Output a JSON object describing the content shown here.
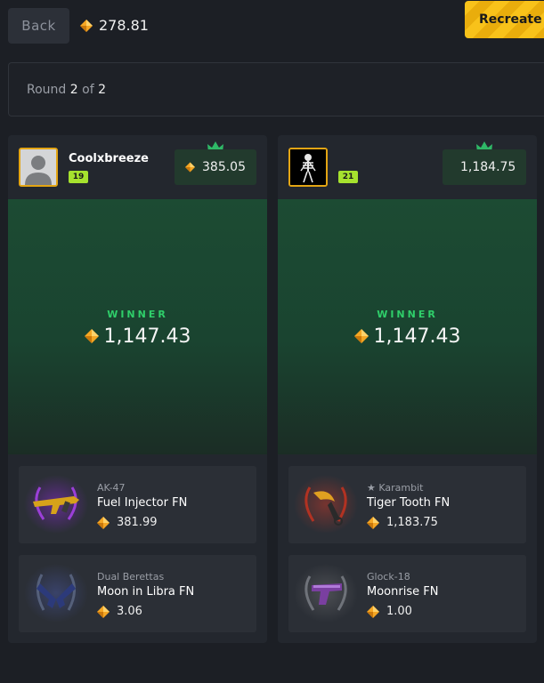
{
  "header": {
    "back_label": "Back",
    "balance": "278.81",
    "recreate_label": "Recreate"
  },
  "round": {
    "prefix": "Round",
    "current": "2",
    "of_label": "of",
    "total": "2"
  },
  "players": [
    {
      "name": "Coolxbreeze",
      "level": "19",
      "total": "385.05",
      "winner_label": "WINNER",
      "winner_amount": "1,147.43",
      "items": [
        {
          "weapon": "AK-47",
          "skin": "Fuel Injector FN",
          "price": "381.99",
          "icon": "ak47-icon",
          "glow": "#8b2bd1"
        },
        {
          "weapon": "Dual Berettas",
          "skin": "Moon in Libra FN",
          "price": "3.06",
          "icon": "dual-berettas-icon",
          "glow": "#4b5aa8"
        }
      ]
    },
    {
      "name": "",
      "level": "21",
      "total": "1,184.75",
      "winner_label": "WINNER",
      "winner_amount": "1,147.43",
      "items": [
        {
          "weapon": "★ Karambit",
          "skin": "Tiger Tooth FN",
          "price": "1,183.75",
          "icon": "karambit-icon",
          "glow": "#c23a2a"
        },
        {
          "weapon": "Glock-18",
          "skin": "Moonrise FN",
          "price": "1.00",
          "icon": "glock-icon",
          "glow": "#8a8a8a"
        }
      ]
    }
  ],
  "colors": {
    "gem": "#f5a623",
    "accent": "#f8c21a",
    "winner": "#2fcf6a",
    "level_badge": "#a6e22e"
  }
}
